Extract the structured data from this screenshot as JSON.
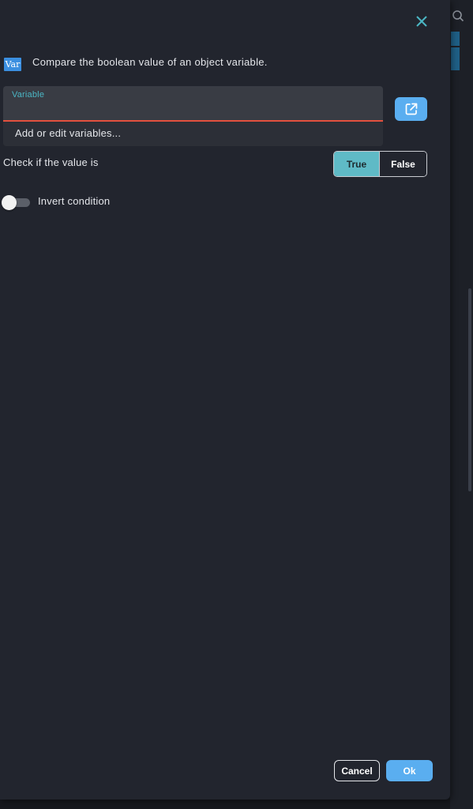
{
  "dialog": {
    "badge": "Var",
    "description": "Compare the boolean value of an object variable.",
    "close_icon": "close-icon"
  },
  "variable_field": {
    "label": "Variable",
    "value": "",
    "placeholder": "",
    "error_color": "#e3503e",
    "open_editor_icon": "external-link-icon"
  },
  "dropdown": {
    "item": "Add or edit variables..."
  },
  "value_check": {
    "label": "Check if the value is",
    "options": [
      "True",
      "False"
    ],
    "selected": "True"
  },
  "invert": {
    "label": "Invert condition",
    "checked": false
  },
  "footer": {
    "cancel_label": "Cancel",
    "ok_label": "Ok"
  },
  "colors": {
    "accent": "#5aaef0",
    "selected_toggle": "#5fbac6",
    "background": "#22252e"
  }
}
